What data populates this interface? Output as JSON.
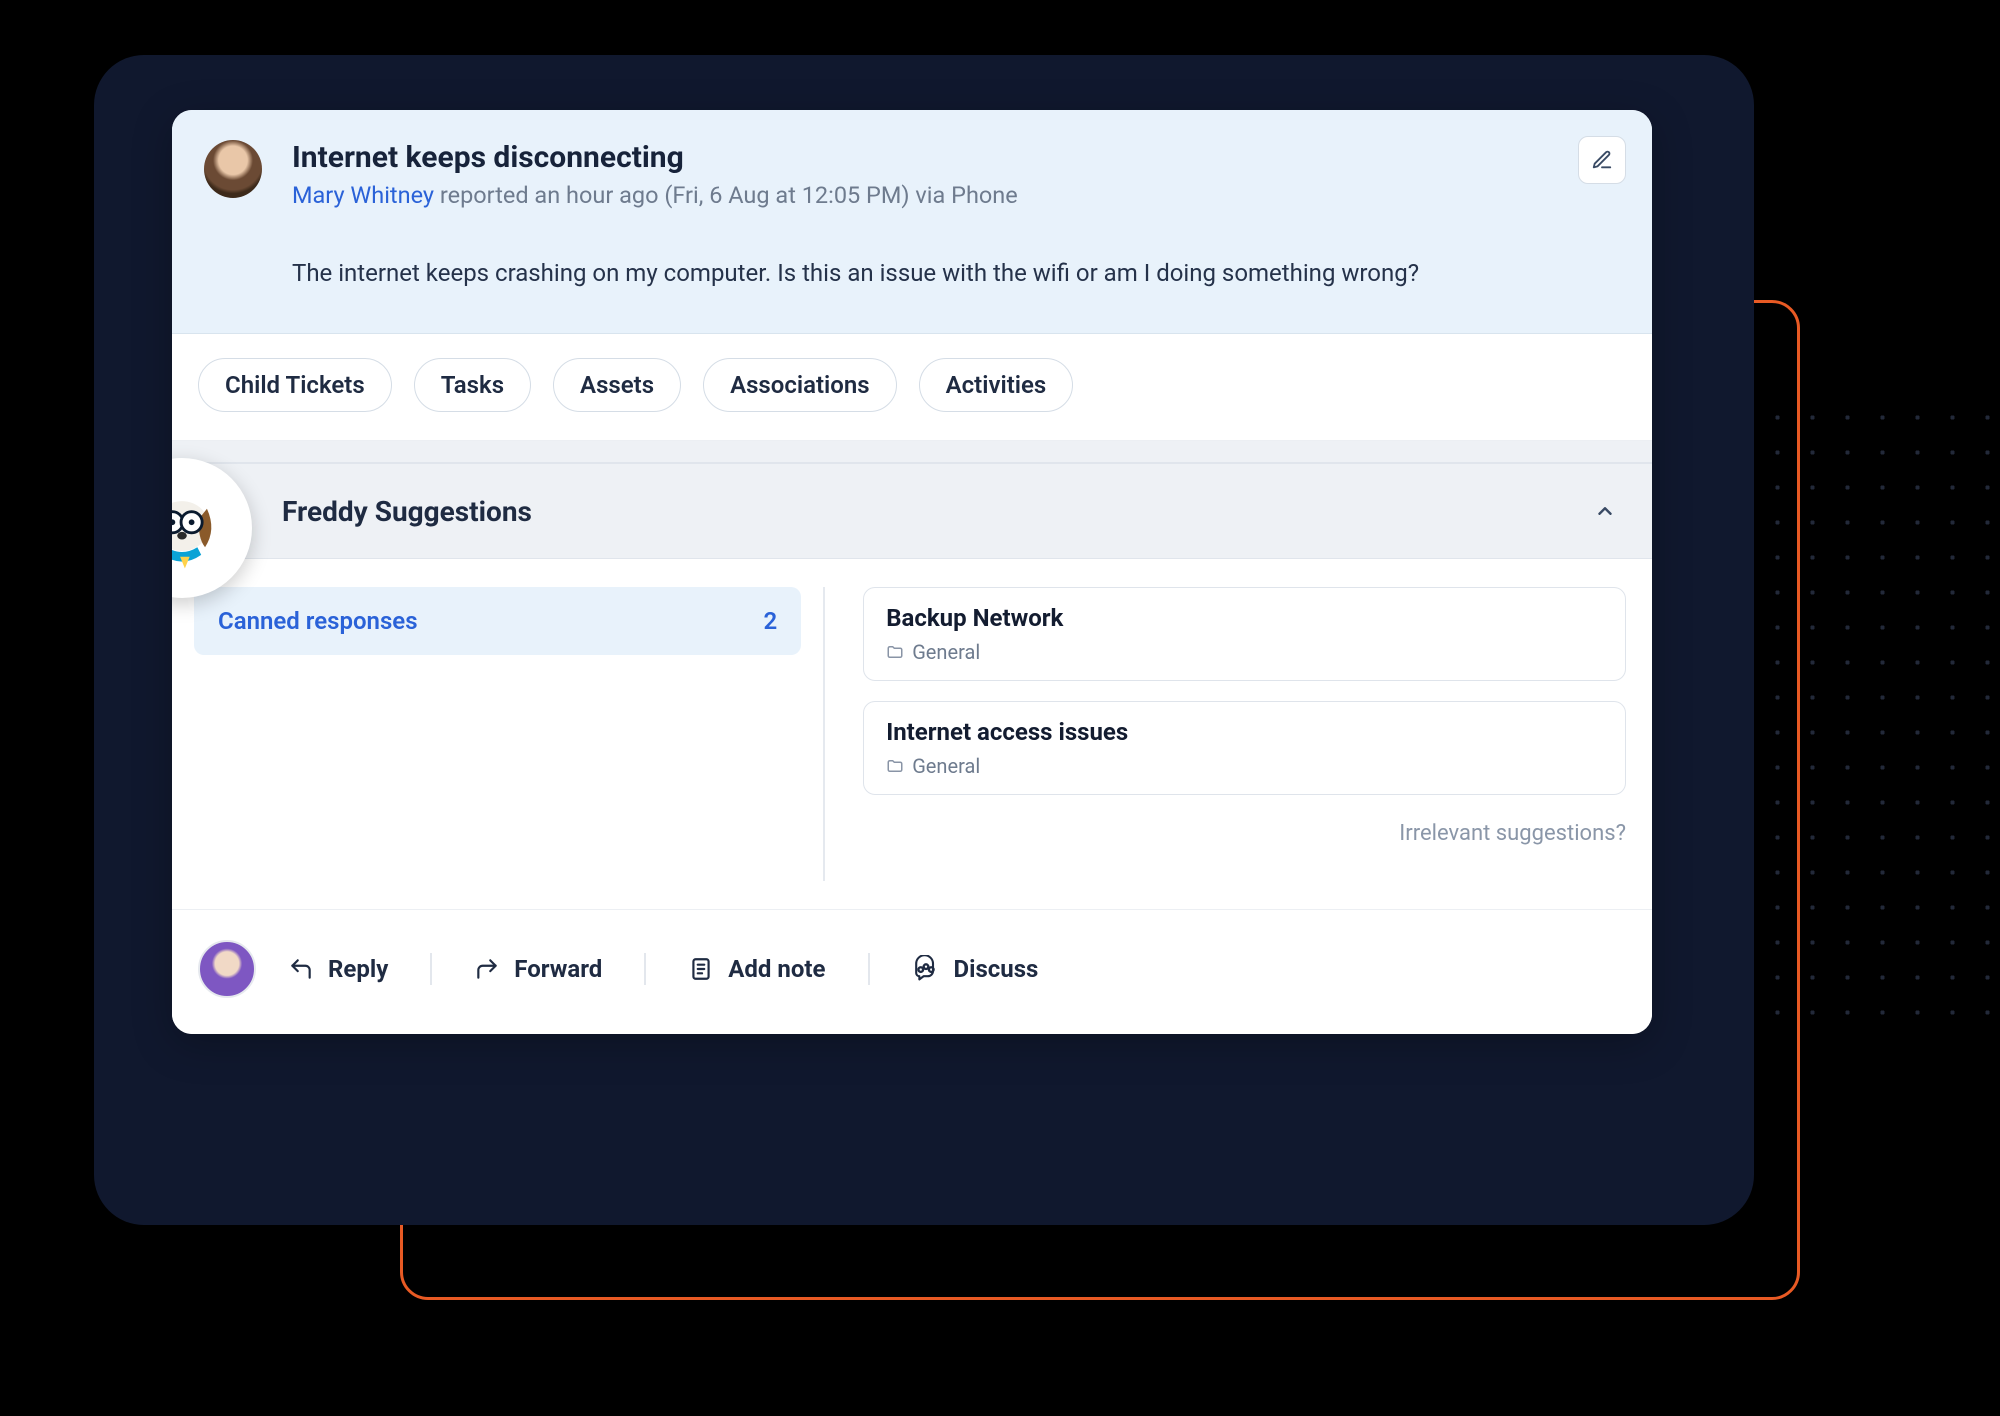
{
  "ticket": {
    "title": "Internet keeps disconnecting",
    "reporter": "Mary Whitney",
    "reported_text": " reported an hour ago (Fri, 6 Aug at 12:05 PM) via Phone",
    "body": "The internet keeps crashing on my computer. Is this an issue with the wifi or am I doing something wrong?"
  },
  "tabs": {
    "child_tickets": "Child Tickets",
    "tasks": "Tasks",
    "assets": "Assets",
    "associations": "Associations",
    "activities": "Activities"
  },
  "suggestions": {
    "title": "Freddy Suggestions",
    "canned_label": "Canned responses",
    "canned_count": "2",
    "responses": [
      {
        "title": "Backup Network",
        "folder": "General"
      },
      {
        "title": "Internet access issues",
        "folder": "General"
      }
    ],
    "irrelevant": "Irrelevant suggestions?"
  },
  "actions": {
    "reply": "Reply",
    "forward": "Forward",
    "add_note": "Add note",
    "discuss": "Discuss"
  }
}
